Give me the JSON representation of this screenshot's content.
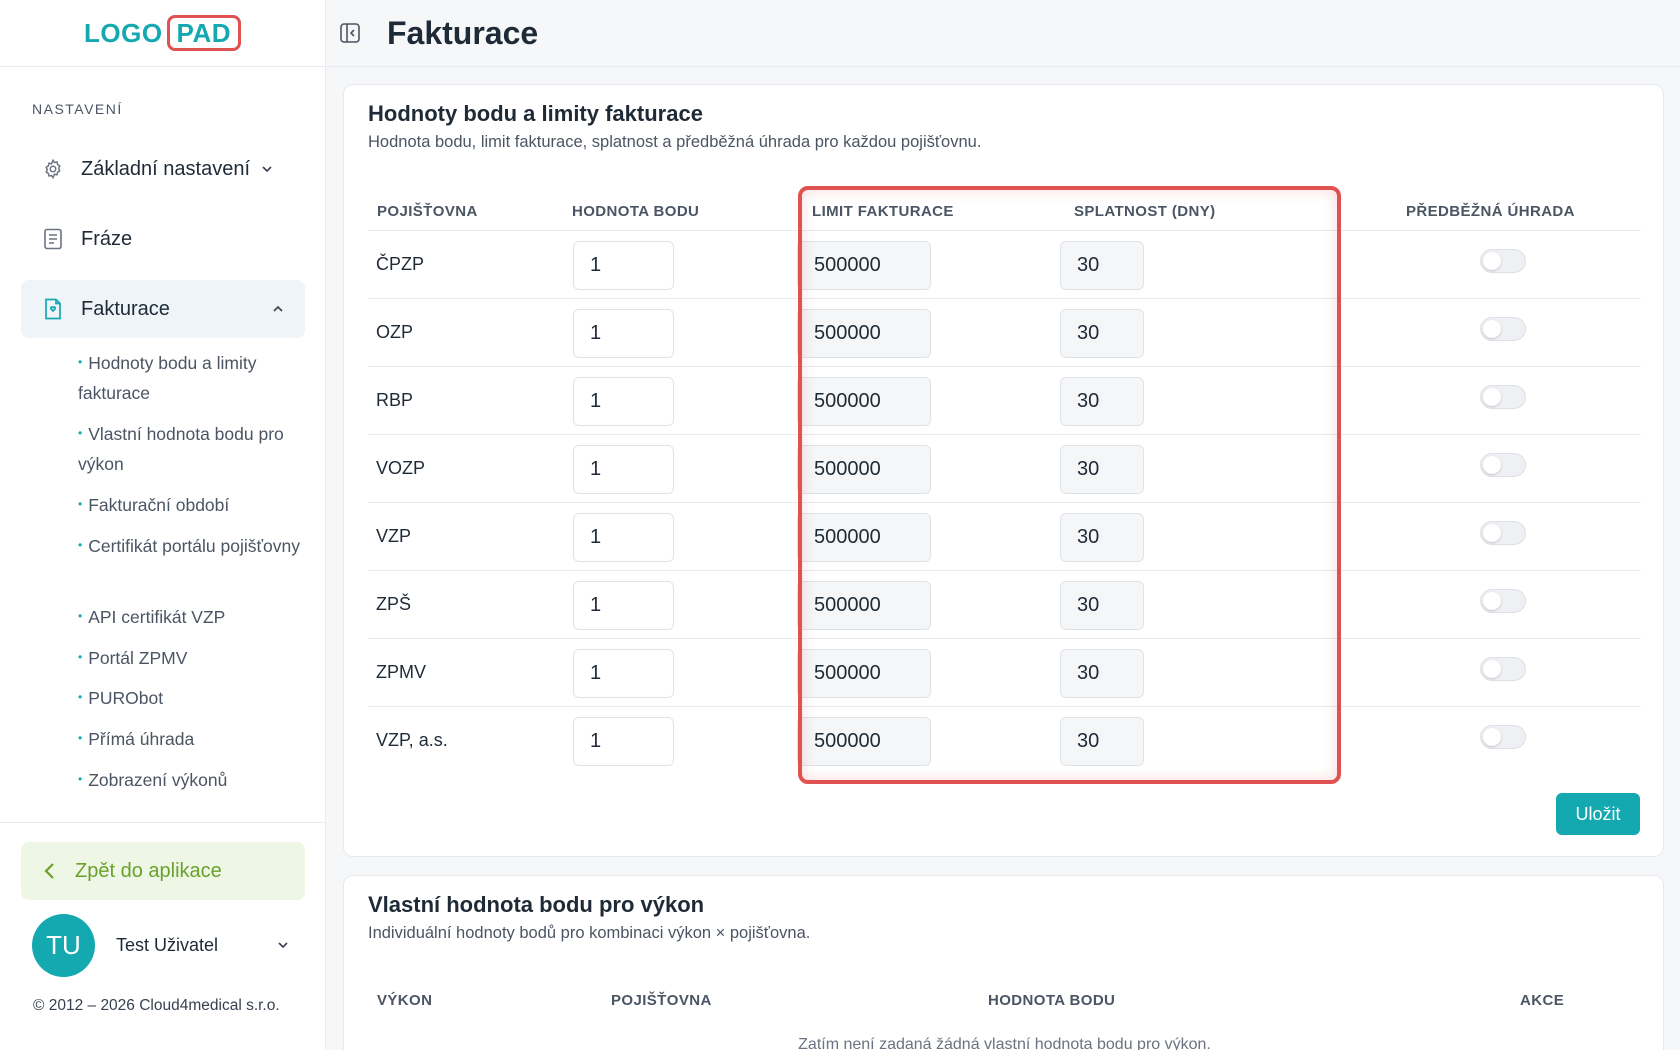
{
  "logo": {
    "part1": "LOGO",
    "part2": "PAD"
  },
  "sidebar": {
    "section_label": "NASTAVENÍ",
    "items": [
      {
        "label": "Základní nastavení",
        "icon": "gear-icon"
      },
      {
        "label": "Fráze",
        "icon": "document-icon"
      },
      {
        "label": "Fakturace",
        "icon": "invoice-icon"
      }
    ],
    "sub_items": [
      {
        "label": "Hodnoty bodu a limity fakturace"
      },
      {
        "label": "Vlastní hodnota bodu pro výkon"
      },
      {
        "label": "Fakturační období"
      },
      {
        "label": "Certifikát portálu pojišťovny"
      },
      {
        "label": "API certifikát VZP"
      },
      {
        "label": "Portál ZPMV"
      },
      {
        "label": "PURObot"
      },
      {
        "label": "Přímá úhrada"
      },
      {
        "label": "Zobrazení výkonů"
      }
    ],
    "back_label": "Zpět do aplikace",
    "user": {
      "initials": "TU",
      "name": "Test Uživatel"
    },
    "copyright": "© 2012 – 2026 Cloud4medical s.r.o."
  },
  "header": {
    "title": "Fakturace"
  },
  "limits_card": {
    "title": "Hodnoty bodu a limity fakturace",
    "subtitle": "Hodnota bodu, limit fakturace, splatnost a předběžná úhrada pro každou pojišťovnu.",
    "columns": [
      "POJIŠŤOVNA",
      "HODNOTA BODU",
      "LIMIT FAKTURACE",
      "SPLATNOST (DNY)",
      "PŘEDBĚŽNÁ ÚHRADA"
    ],
    "rows": [
      {
        "name": "ČPZP",
        "point": "1",
        "limit": "500000",
        "due": "30",
        "prepay": false
      },
      {
        "name": "OZP",
        "point": "1",
        "limit": "500000",
        "due": "30",
        "prepay": false
      },
      {
        "name": "RBP",
        "point": "1",
        "limit": "500000",
        "due": "30",
        "prepay": false
      },
      {
        "name": "VOZP",
        "point": "1",
        "limit": "500000",
        "due": "30",
        "prepay": false
      },
      {
        "name": "VZP",
        "point": "1",
        "limit": "500000",
        "due": "30",
        "prepay": false
      },
      {
        "name": "ZPŠ",
        "point": "1",
        "limit": "500000",
        "due": "30",
        "prepay": false
      },
      {
        "name": "ZPMV",
        "point": "1",
        "limit": "500000",
        "due": "30",
        "prepay": false
      },
      {
        "name": "VZP, a.s.",
        "point": "1",
        "limit": "500000",
        "due": "30",
        "prepay": false
      }
    ],
    "save_label": "Uložit"
  },
  "custom_card": {
    "title": "Vlastní hodnota bodu pro výkon",
    "subtitle": "Individuální hodnoty bodů pro kombinaci výkon × pojišťovna.",
    "columns": [
      "VÝKON",
      "POJIŠŤOVNA",
      "HODNOTA BODU",
      "AKCE"
    ],
    "empty": "Zatím není zadaná žádná vlastní hodnota bodu pro výkon."
  },
  "colors": {
    "accent": "#14a8b0",
    "highlight": "#e05252",
    "back_green": "#6aa12a"
  }
}
